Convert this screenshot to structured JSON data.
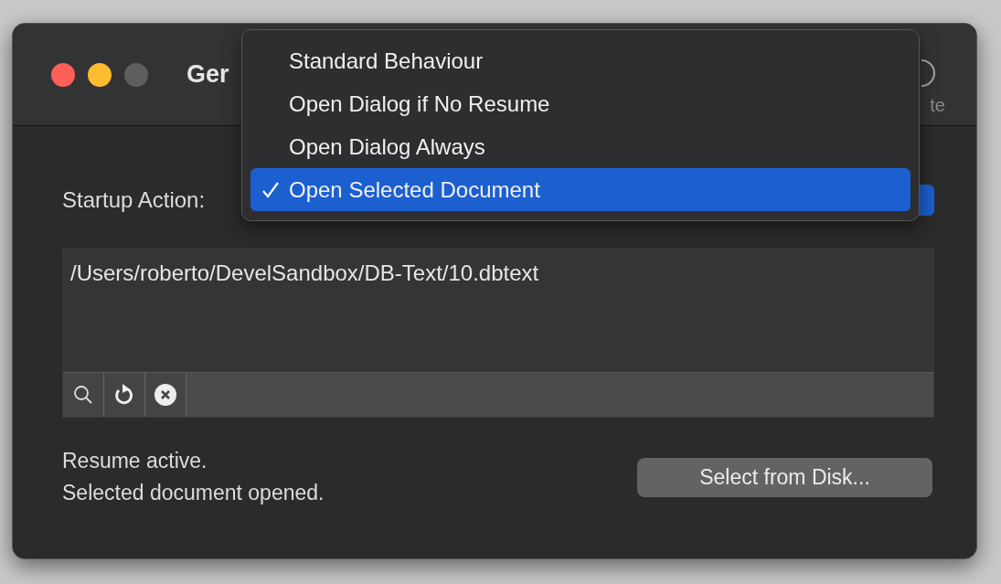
{
  "window": {
    "title": "Ger",
    "toolbar_label": "te"
  },
  "startup_action": {
    "label": "Startup Action:"
  },
  "menu": {
    "items": [
      {
        "label": "Standard Behaviour",
        "selected": false
      },
      {
        "label": "Open Dialog if No Resume",
        "selected": false
      },
      {
        "label": "Open Dialog Always",
        "selected": false
      },
      {
        "label": "Open Selected Document",
        "selected": true
      }
    ]
  },
  "document_list": {
    "rows": [
      "/Users/roberto/DevelSandbox/DB-Text/10.dbtext"
    ]
  },
  "status_lines": [
    "Resume active.",
    "Selected document opened."
  ],
  "buttons": [
    "Select from Disk..."
  ]
}
